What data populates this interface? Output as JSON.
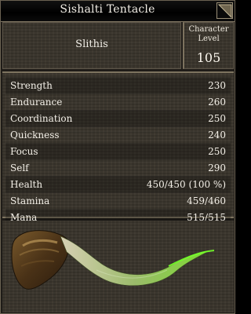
{
  "window": {
    "title": "Sishalti Tentacle"
  },
  "header": {
    "name": "Slithis",
    "level_label": "Character\nLevel",
    "level_value": "105"
  },
  "stats": [
    {
      "label": "Strength",
      "value": "230"
    },
    {
      "label": "Endurance",
      "value": "260"
    },
    {
      "label": "Coordination",
      "value": "250"
    },
    {
      "label": "Quickness",
      "value": "240"
    },
    {
      "label": "Focus",
      "value": "250"
    },
    {
      "label": "Self",
      "value": "290"
    },
    {
      "label": "Health",
      "value": "450/450 (100 %)"
    },
    {
      "label": "Stamina",
      "value": "459/460"
    },
    {
      "label": "Mana",
      "value": "515/515"
    }
  ],
  "icons": {
    "corner": "resize-corner-icon",
    "item": "tentacle-icon"
  }
}
